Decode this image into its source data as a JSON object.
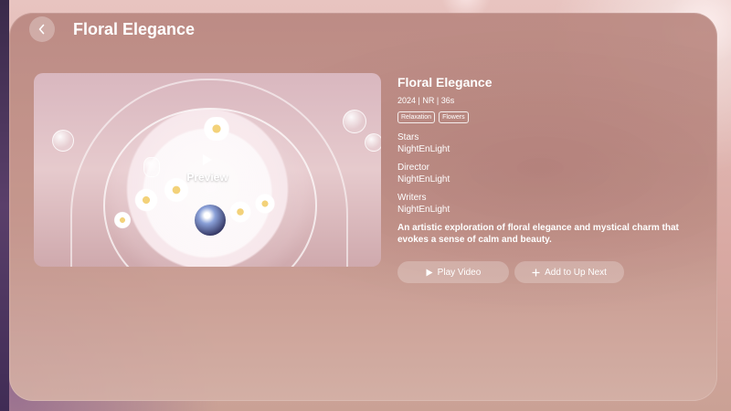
{
  "header": {
    "back_icon": "chevron-left-icon",
    "title": "Floral Elegance"
  },
  "preview": {
    "label": "Preview",
    "icon": "play-icon"
  },
  "details": {
    "title": "Floral Elegance",
    "meta": "2024 | NR | 36s",
    "tags": [
      "Relaxation",
      "Flowers"
    ],
    "credits": [
      {
        "label": "Stars",
        "value": "NightEnLight"
      },
      {
        "label": "Director",
        "value": "NightEnLight"
      },
      {
        "label": "Writers",
        "value": "NightEnLight"
      }
    ],
    "description": "An artistic exploration of floral elegance and mystical charm that evokes a sense of calm and beauty."
  },
  "actions": {
    "play_label": "Play Video",
    "play_icon": "play-icon",
    "add_label": "Add to Up Next",
    "add_icon": "plus-icon"
  },
  "colors": {
    "panel": "#c0928a",
    "text": "#ffffff"
  }
}
